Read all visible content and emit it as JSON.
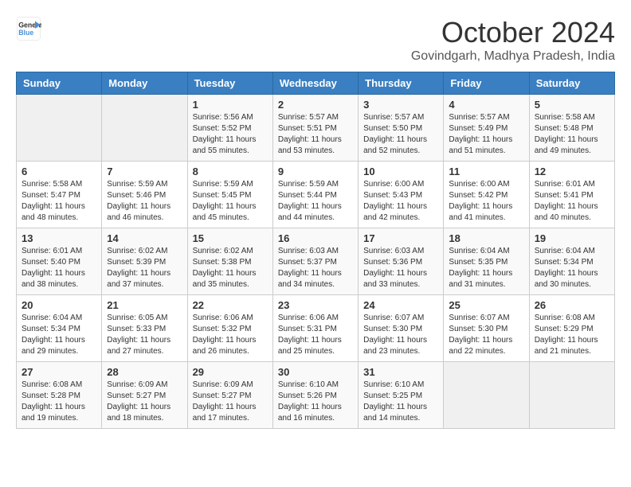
{
  "header": {
    "logo_line1": "General",
    "logo_line2": "Blue",
    "month": "October 2024",
    "location": "Govindgarh, Madhya Pradesh, India"
  },
  "weekdays": [
    "Sunday",
    "Monday",
    "Tuesday",
    "Wednesday",
    "Thursday",
    "Friday",
    "Saturday"
  ],
  "weeks": [
    [
      {
        "day": "",
        "sunrise": "",
        "sunset": "",
        "daylight": ""
      },
      {
        "day": "",
        "sunrise": "",
        "sunset": "",
        "daylight": ""
      },
      {
        "day": "1",
        "sunrise": "Sunrise: 5:56 AM",
        "sunset": "Sunset: 5:52 PM",
        "daylight": "Daylight: 11 hours and 55 minutes."
      },
      {
        "day": "2",
        "sunrise": "Sunrise: 5:57 AM",
        "sunset": "Sunset: 5:51 PM",
        "daylight": "Daylight: 11 hours and 53 minutes."
      },
      {
        "day": "3",
        "sunrise": "Sunrise: 5:57 AM",
        "sunset": "Sunset: 5:50 PM",
        "daylight": "Daylight: 11 hours and 52 minutes."
      },
      {
        "day": "4",
        "sunrise": "Sunrise: 5:57 AM",
        "sunset": "Sunset: 5:49 PM",
        "daylight": "Daylight: 11 hours and 51 minutes."
      },
      {
        "day": "5",
        "sunrise": "Sunrise: 5:58 AM",
        "sunset": "Sunset: 5:48 PM",
        "daylight": "Daylight: 11 hours and 49 minutes."
      }
    ],
    [
      {
        "day": "6",
        "sunrise": "Sunrise: 5:58 AM",
        "sunset": "Sunset: 5:47 PM",
        "daylight": "Daylight: 11 hours and 48 minutes."
      },
      {
        "day": "7",
        "sunrise": "Sunrise: 5:59 AM",
        "sunset": "Sunset: 5:46 PM",
        "daylight": "Daylight: 11 hours and 46 minutes."
      },
      {
        "day": "8",
        "sunrise": "Sunrise: 5:59 AM",
        "sunset": "Sunset: 5:45 PM",
        "daylight": "Daylight: 11 hours and 45 minutes."
      },
      {
        "day": "9",
        "sunrise": "Sunrise: 5:59 AM",
        "sunset": "Sunset: 5:44 PM",
        "daylight": "Daylight: 11 hours and 44 minutes."
      },
      {
        "day": "10",
        "sunrise": "Sunrise: 6:00 AM",
        "sunset": "Sunset: 5:43 PM",
        "daylight": "Daylight: 11 hours and 42 minutes."
      },
      {
        "day": "11",
        "sunrise": "Sunrise: 6:00 AM",
        "sunset": "Sunset: 5:42 PM",
        "daylight": "Daylight: 11 hours and 41 minutes."
      },
      {
        "day": "12",
        "sunrise": "Sunrise: 6:01 AM",
        "sunset": "Sunset: 5:41 PM",
        "daylight": "Daylight: 11 hours and 40 minutes."
      }
    ],
    [
      {
        "day": "13",
        "sunrise": "Sunrise: 6:01 AM",
        "sunset": "Sunset: 5:40 PM",
        "daylight": "Daylight: 11 hours and 38 minutes."
      },
      {
        "day": "14",
        "sunrise": "Sunrise: 6:02 AM",
        "sunset": "Sunset: 5:39 PM",
        "daylight": "Daylight: 11 hours and 37 minutes."
      },
      {
        "day": "15",
        "sunrise": "Sunrise: 6:02 AM",
        "sunset": "Sunset: 5:38 PM",
        "daylight": "Daylight: 11 hours and 35 minutes."
      },
      {
        "day": "16",
        "sunrise": "Sunrise: 6:03 AM",
        "sunset": "Sunset: 5:37 PM",
        "daylight": "Daylight: 11 hours and 34 minutes."
      },
      {
        "day": "17",
        "sunrise": "Sunrise: 6:03 AM",
        "sunset": "Sunset: 5:36 PM",
        "daylight": "Daylight: 11 hours and 33 minutes."
      },
      {
        "day": "18",
        "sunrise": "Sunrise: 6:04 AM",
        "sunset": "Sunset: 5:35 PM",
        "daylight": "Daylight: 11 hours and 31 minutes."
      },
      {
        "day": "19",
        "sunrise": "Sunrise: 6:04 AM",
        "sunset": "Sunset: 5:34 PM",
        "daylight": "Daylight: 11 hours and 30 minutes."
      }
    ],
    [
      {
        "day": "20",
        "sunrise": "Sunrise: 6:04 AM",
        "sunset": "Sunset: 5:34 PM",
        "daylight": "Daylight: 11 hours and 29 minutes."
      },
      {
        "day": "21",
        "sunrise": "Sunrise: 6:05 AM",
        "sunset": "Sunset: 5:33 PM",
        "daylight": "Daylight: 11 hours and 27 minutes."
      },
      {
        "day": "22",
        "sunrise": "Sunrise: 6:06 AM",
        "sunset": "Sunset: 5:32 PM",
        "daylight": "Daylight: 11 hours and 26 minutes."
      },
      {
        "day": "23",
        "sunrise": "Sunrise: 6:06 AM",
        "sunset": "Sunset: 5:31 PM",
        "daylight": "Daylight: 11 hours and 25 minutes."
      },
      {
        "day": "24",
        "sunrise": "Sunrise: 6:07 AM",
        "sunset": "Sunset: 5:30 PM",
        "daylight": "Daylight: 11 hours and 23 minutes."
      },
      {
        "day": "25",
        "sunrise": "Sunrise: 6:07 AM",
        "sunset": "Sunset: 5:30 PM",
        "daylight": "Daylight: 11 hours and 22 minutes."
      },
      {
        "day": "26",
        "sunrise": "Sunrise: 6:08 AM",
        "sunset": "Sunset: 5:29 PM",
        "daylight": "Daylight: 11 hours and 21 minutes."
      }
    ],
    [
      {
        "day": "27",
        "sunrise": "Sunrise: 6:08 AM",
        "sunset": "Sunset: 5:28 PM",
        "daylight": "Daylight: 11 hours and 19 minutes."
      },
      {
        "day": "28",
        "sunrise": "Sunrise: 6:09 AM",
        "sunset": "Sunset: 5:27 PM",
        "daylight": "Daylight: 11 hours and 18 minutes."
      },
      {
        "day": "29",
        "sunrise": "Sunrise: 6:09 AM",
        "sunset": "Sunset: 5:27 PM",
        "daylight": "Daylight: 11 hours and 17 minutes."
      },
      {
        "day": "30",
        "sunrise": "Sunrise: 6:10 AM",
        "sunset": "Sunset: 5:26 PM",
        "daylight": "Daylight: 11 hours and 16 minutes."
      },
      {
        "day": "31",
        "sunrise": "Sunrise: 6:10 AM",
        "sunset": "Sunset: 5:25 PM",
        "daylight": "Daylight: 11 hours and 14 minutes."
      },
      {
        "day": "",
        "sunrise": "",
        "sunset": "",
        "daylight": ""
      },
      {
        "day": "",
        "sunrise": "",
        "sunset": "",
        "daylight": ""
      }
    ]
  ]
}
